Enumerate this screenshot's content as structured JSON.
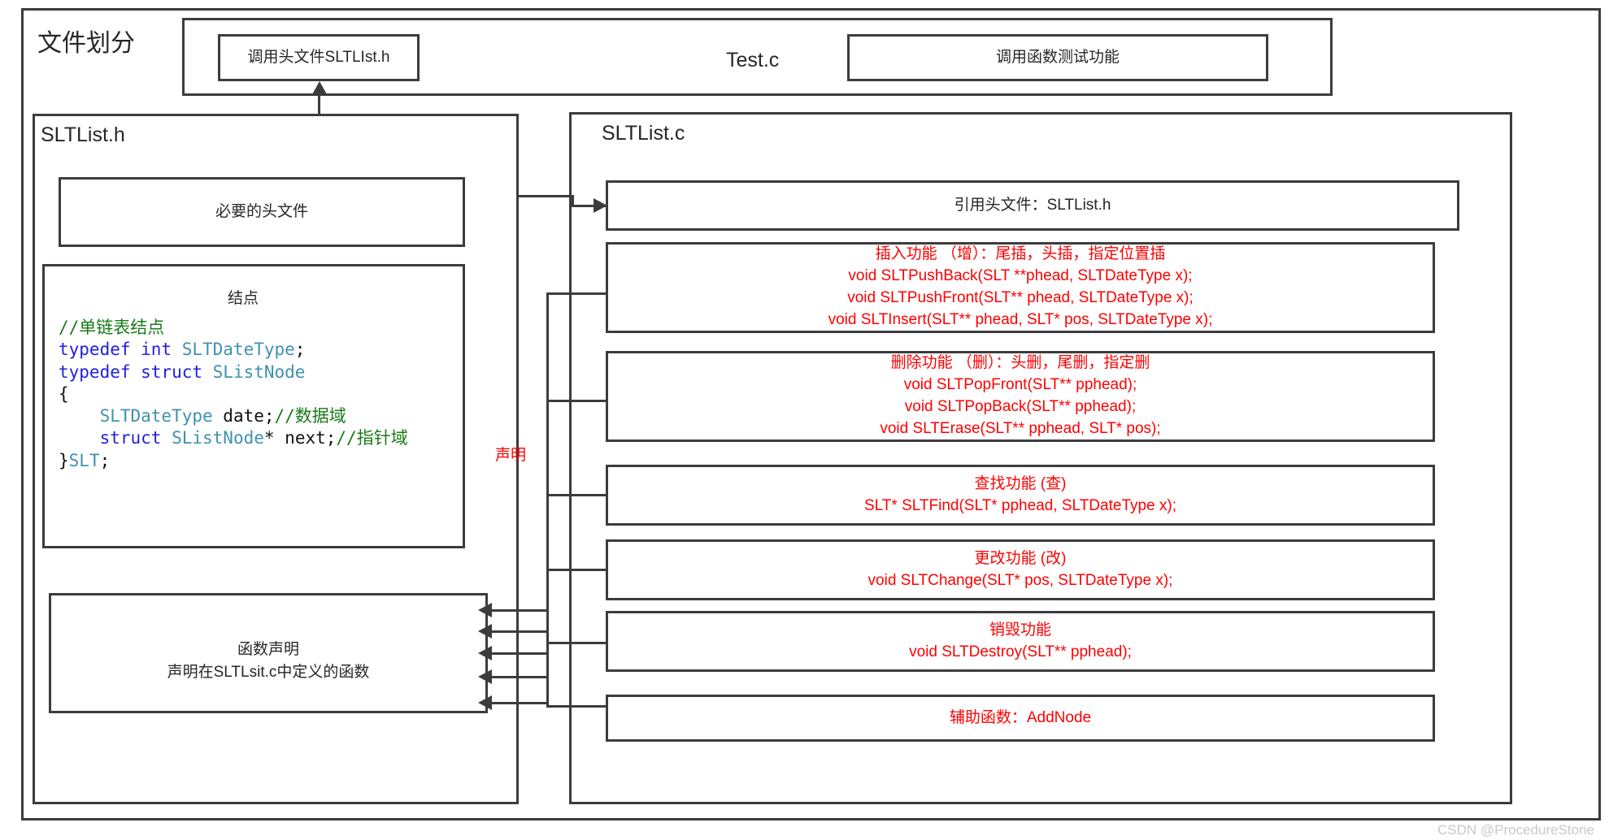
{
  "diagram": {
    "title": "文件划分",
    "watermark": "CSDN @ProcedureStone"
  },
  "test_section": {
    "include_box": "调用头文件SLTLIst.h",
    "file_label": "Test.c",
    "call_box": "调用函数测试功能"
  },
  "header_file": {
    "file_label": "SLTList.h",
    "headers_box": "必要的头文件",
    "node_caption": "结点",
    "code_lines": [
      {
        "segments": [
          {
            "text": "//单链表结点",
            "color": "green"
          }
        ]
      },
      {
        "segments": [
          {
            "text": "typedef int ",
            "color": "blue"
          },
          {
            "text": "SLTDateType",
            "color": "teal"
          },
          {
            "text": ";",
            "color": "black"
          }
        ]
      },
      {
        "segments": [
          {
            "text": "typedef struct ",
            "color": "blue"
          },
          {
            "text": "SListNode",
            "color": "teal"
          }
        ]
      },
      {
        "segments": [
          {
            "text": "{",
            "color": "black"
          }
        ]
      },
      {
        "segments": [
          {
            "text": "    ",
            "color": "black"
          },
          {
            "text": "SLTDateType",
            "color": "teal"
          },
          {
            "text": " date;",
            "color": "black"
          },
          {
            "text": "//数据域",
            "color": "green"
          }
        ]
      },
      {
        "segments": [
          {
            "text": "    ",
            "color": "black"
          },
          {
            "text": "struct ",
            "color": "blue"
          },
          {
            "text": "SListNode",
            "color": "teal"
          },
          {
            "text": "* next;",
            "color": "black"
          },
          {
            "text": "//指针域",
            "color": "green"
          }
        ]
      },
      {
        "segments": [
          {
            "text": "}",
            "color": "black"
          },
          {
            "text": "SLT",
            "color": "teal"
          },
          {
            "text": ";",
            "color": "black"
          }
        ]
      }
    ],
    "declaration_box": {
      "line1": "函数声明",
      "line2": "声明在SLTLsit.c中定义的函数"
    }
  },
  "source_file": {
    "file_label": "SLTList.c",
    "declaration_arrow_label": "声明",
    "include_box": "引用头文件：SLTList.h",
    "function_groups": [
      {
        "name": "insert",
        "lines": [
          "插入功能 （增）：尾插，头插，指定位置插",
          "void SLTPushBack(SLT **phead, SLTDateType x);",
          "void SLTPushFront(SLT** phead, SLTDateType x);",
          "void SLTInsert(SLT** phead, SLT* pos, SLTDateType x);"
        ]
      },
      {
        "name": "delete",
        "lines": [
          "删除功能 （删）：头删，尾删，指定删",
          "void SLTPopFront(SLT** pphead);",
          "void SLTPopBack(SLT** pphead);",
          "void SLTErase(SLT** pphead, SLT* pos);"
        ]
      },
      {
        "name": "find",
        "lines": [
          "查找功能 (查)",
          "SLT* SLTFind(SLT* pphead, SLTDateType x);"
        ]
      },
      {
        "name": "change",
        "lines": [
          "更改功能 (改)",
          "void SLTChange(SLT* pos, SLTDateType x);"
        ]
      },
      {
        "name": "destroy",
        "lines": [
          "销毁功能",
          "void SLTDestroy(SLT** pphead);"
        ]
      },
      {
        "name": "helper",
        "lines": [
          "辅助函数：AddNode"
        ]
      }
    ]
  },
  "colors": {
    "stroke": "#3c3c3c",
    "red": "#ff0000",
    "code_green": "#1a7a1a",
    "code_blue": "#2020e0",
    "code_teal": "#3f92b0",
    "watermark": "#c9c9c9"
  }
}
